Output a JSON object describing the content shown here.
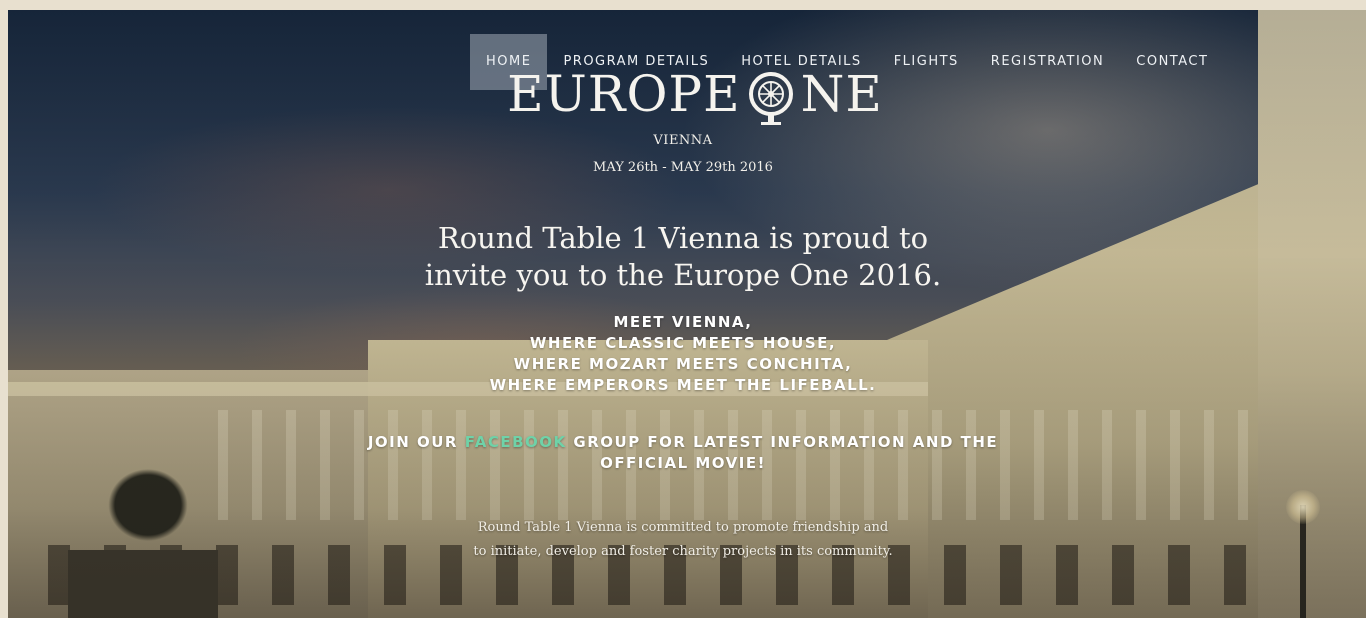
{
  "nav": {
    "items": [
      {
        "label": "HOME",
        "active": true
      },
      {
        "label": "PROGRAM DETAILS",
        "active": false
      },
      {
        "label": "HOTEL DETAILS",
        "active": false
      },
      {
        "label": "FLIGHTS",
        "active": false
      },
      {
        "label": "REGISTRATION",
        "active": false
      },
      {
        "label": "CONTACT",
        "active": false
      }
    ]
  },
  "logo": {
    "word_left": "EUROPE",
    "word_right": "NE",
    "emblem_icon": "round-table-wheel-icon"
  },
  "event": {
    "city": "VIENNA",
    "dates": "MAY 26th - MAY 29th 2016"
  },
  "headline": {
    "line1": "Round Table 1 Vienna is proud to",
    "line2": "invite you to the Europe One 2016."
  },
  "tagline": {
    "line1": "MEET VIENNA,",
    "line2": "WHERE CLASSIC MEETS HOUSE,",
    "line3": "WHERE MOZART MEETS CONCHITA,",
    "line4": "WHERE EMPERORS MEET THE LIFEBALL."
  },
  "join": {
    "prefix": "JOIN OUR ",
    "link": "FACEBOOK",
    "suffix": " GROUP FOR LATEST INFORMATION AND THE",
    "line2": "OFFICIAL MOVIE!"
  },
  "mission": {
    "line1": "Round Table 1 Vienna is committed to promote friendship and",
    "line2": "to initiate, develop and foster charity projects in its community."
  },
  "colors": {
    "accent_link": "#6fd2a8",
    "nav_active_bg": "#a0aab4",
    "text": "#ffffff"
  }
}
